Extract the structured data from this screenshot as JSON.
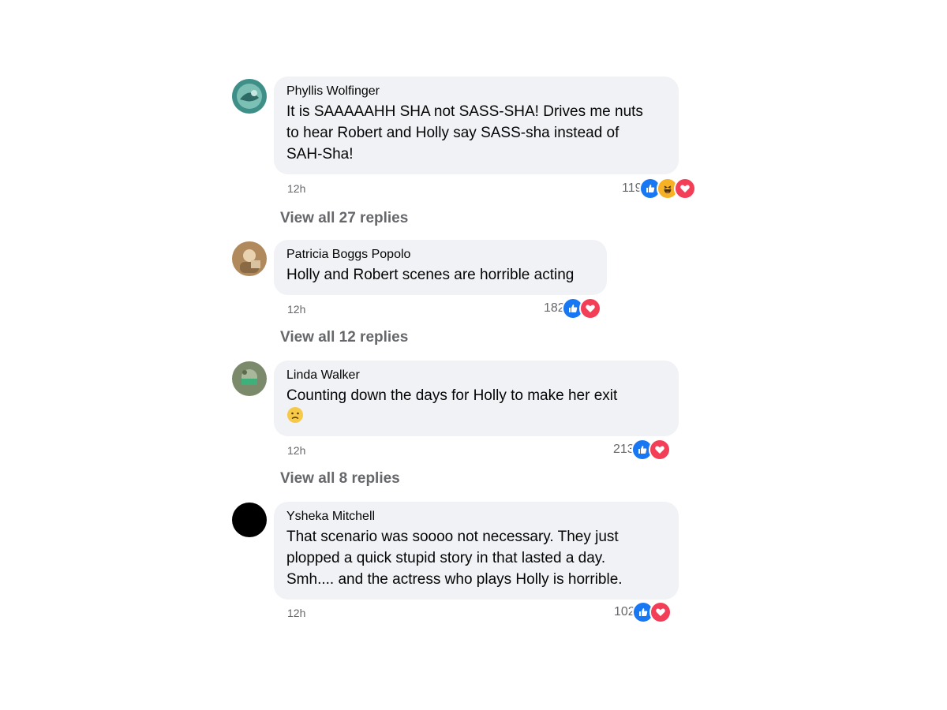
{
  "comments": [
    {
      "author": "Phyllis Wolfinger",
      "lines": [
        "It is SAAAAAHH SHA not SASS-SHA! Drives me nuts",
        "to hear Robert and Holly say SASS-sha instead of",
        "SAH-Sha!"
      ],
      "time": "12h",
      "reaction_count": "119",
      "reactions": [
        "like-icon",
        "haha-icon",
        "love-icon"
      ],
      "view_replies": "View all 27 replies"
    },
    {
      "author": "Patricia Boggs Popolo",
      "lines": [
        "Holly and Robert scenes are horrible acting"
      ],
      "time": "12h",
      "reaction_count": "182",
      "reactions": [
        "like-icon",
        "love-icon"
      ],
      "view_replies": "View all 12 replies"
    },
    {
      "author": "Linda Walker",
      "lines": [
        "Counting down the days for Holly to make her exit"
      ],
      "emoji": "worried-face-icon",
      "time": "12h",
      "reaction_count": "213",
      "reactions": [
        "like-icon",
        "love-icon"
      ],
      "view_replies": "View all 8 replies"
    },
    {
      "author": "Ysheka Mitchell",
      "lines": [
        "That scenario was soooo not necessary. They just",
        "plopped a quick stupid story in that lasted a day.",
        "Smh.... and the actress who plays Holly is horrible."
      ],
      "time": "12h",
      "reaction_count": "102",
      "reactions": [
        "like-icon",
        "love-icon"
      ]
    }
  ],
  "colors": {
    "bubble": "#f0f2f5",
    "meta": "#65676b",
    "like": "#1877f2",
    "love": "#f33e58",
    "haha": "#f7b125"
  }
}
